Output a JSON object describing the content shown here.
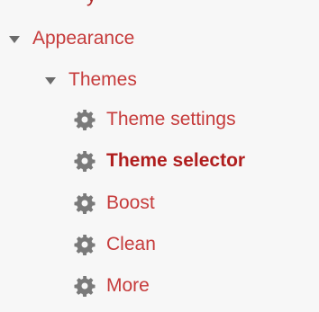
{
  "tree": {
    "partial_label": "y",
    "appearance_label": "Appearance",
    "themes_label": "Themes",
    "items": [
      {
        "label": "Theme settings",
        "icon": "gear-icon"
      },
      {
        "label": "Theme selector",
        "icon": "gear-icon",
        "active": true
      },
      {
        "label": "Boost",
        "icon": "gear-icon"
      },
      {
        "label": "Clean",
        "icon": "gear-icon"
      },
      {
        "label": "More",
        "icon": "gear-icon"
      }
    ]
  },
  "colors": {
    "link": "#c63b3b",
    "active_link": "#b01e1e",
    "caret": "#6b6b6b",
    "icon": "#7a7a7a",
    "background": "#f7f7f7"
  }
}
